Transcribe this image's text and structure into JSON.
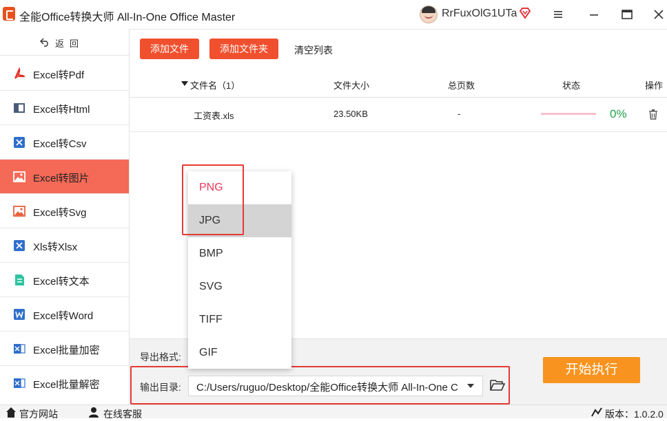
{
  "window": {
    "title": "全能Office转换大师 All-In-One Office Master",
    "username": "RrFuxOlG1UTa"
  },
  "sidebar": {
    "back_label": "返回",
    "items": [
      {
        "label": "Excel转Pdf",
        "icon": "pdf-icon"
      },
      {
        "label": "Excel转Html",
        "icon": "html-icon"
      },
      {
        "label": "Excel转Csv",
        "icon": "excel-icon"
      },
      {
        "label": "Excel转图片",
        "icon": "image-icon",
        "active": true
      },
      {
        "label": "Excel转Svg",
        "icon": "image-icon"
      },
      {
        "label": "Xls转Xlsx",
        "icon": "excel-icon"
      },
      {
        "label": "Excel转文本",
        "icon": "text-icon"
      },
      {
        "label": "Excel转Word",
        "icon": "word-icon"
      },
      {
        "label": "Excel批量加密",
        "icon": "lock-file-icon"
      },
      {
        "label": "Excel批量解密",
        "icon": "unlock-file-icon"
      }
    ]
  },
  "toolbar": {
    "add_file": "添加文件",
    "add_folder": "添加文件夹",
    "clear_list": "清空列表"
  },
  "table": {
    "headers": {
      "name": "文件名（1）",
      "size": "文件大小",
      "pages": "总页数",
      "status": "状态",
      "action": "操作"
    },
    "rows": [
      {
        "name": "工资表.xls",
        "size": "23.50KB",
        "pages": "-",
        "progress": "0%"
      }
    ]
  },
  "settings": {
    "format_label": "导出格式:",
    "output_label": "输出目录:",
    "output_dir": "C:/Users/ruguo/Desktop/全能Office转换大师 All-In-One C",
    "start_button": "开始执行"
  },
  "format_dropdown": {
    "options": [
      "PNG",
      "JPG",
      "BMP",
      "SVG",
      "TIFF",
      "GIF"
    ],
    "selected": "PNG",
    "hovered": "JPG"
  },
  "footer": {
    "website": "官方网站",
    "support": "在线客服",
    "version": "版本：1.0.2.0"
  },
  "colors": {
    "accent_red": "#f0502e",
    "active_nav": "#f56a57",
    "start_orange": "#f7931e",
    "progress_green": "#21a24a",
    "selected_option": "#e8385a"
  }
}
